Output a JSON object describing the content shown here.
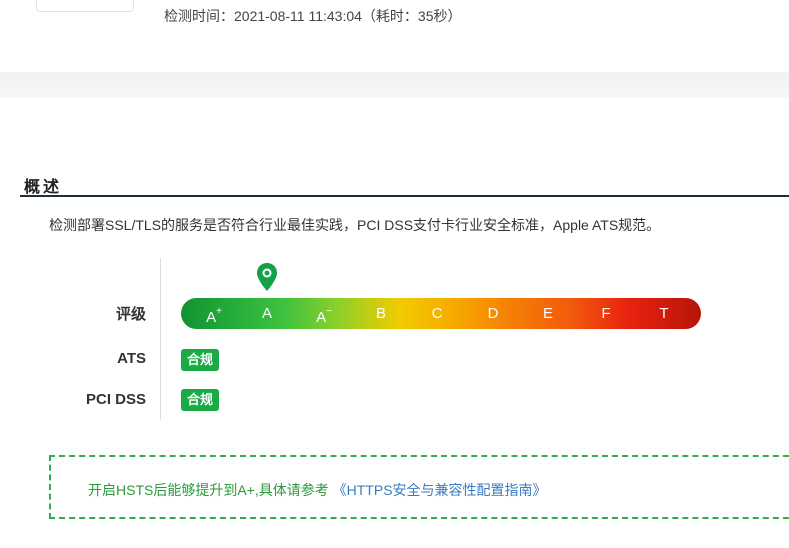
{
  "header": {
    "time_line": "检测时间：2021-08-11 11:43:04（耗时：35秒）"
  },
  "overview": {
    "title": "概述",
    "description": "检测部署SSL/TLS的服务是否符合行业最佳实践，PCI DSS支付卡行业安全标准，Apple ATS规范。"
  },
  "rating": {
    "label": "评级",
    "current_grade": "A",
    "grades": [
      {
        "base": "A",
        "mod": "+"
      },
      {
        "base": "A",
        "mod": ""
      },
      {
        "base": "A",
        "mod": "−"
      },
      {
        "base": "B",
        "mod": ""
      },
      {
        "base": "C",
        "mod": ""
      },
      {
        "base": "D",
        "mod": ""
      },
      {
        "base": "E",
        "mod": ""
      },
      {
        "base": "F",
        "mod": ""
      },
      {
        "base": "T",
        "mod": ""
      }
    ]
  },
  "compliance": {
    "ats_label": "ATS",
    "ats_status": "合规",
    "pci_label": "PCI DSS",
    "pci_status": "合规",
    "status_color": "#1aab46"
  },
  "tip": {
    "text": "开启HSTS后能够提升到A+,具体请参考 ",
    "link_text": "《HTTPS安全与兼容性配置指南》"
  }
}
